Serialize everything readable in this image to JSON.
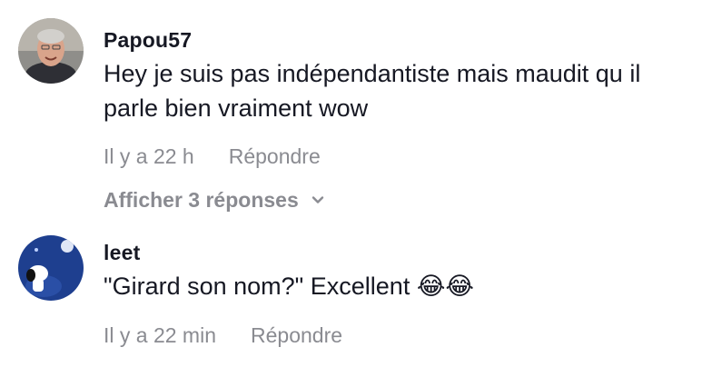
{
  "comments": [
    {
      "username": "Papou57",
      "avatar_icon": "user-photo-older-man",
      "text": "Hey je suis pas indépendantiste mais maudit qu il parle bien vraiment wow",
      "time": "Il y a 22 h",
      "reply_label": "Répondre",
      "view_replies_label": "Afficher 3 réponses"
    },
    {
      "username": "leet",
      "avatar_icon": "snoopy-moon-avatar",
      "text": "\"Girard son nom?\" Excellent",
      "emoji": "😂😂",
      "time": "Il y a 22 min",
      "reply_label": "Répondre"
    }
  ],
  "colors": {
    "text": "#161823",
    "muted": "#8a8b91",
    "background": "#ffffff"
  }
}
